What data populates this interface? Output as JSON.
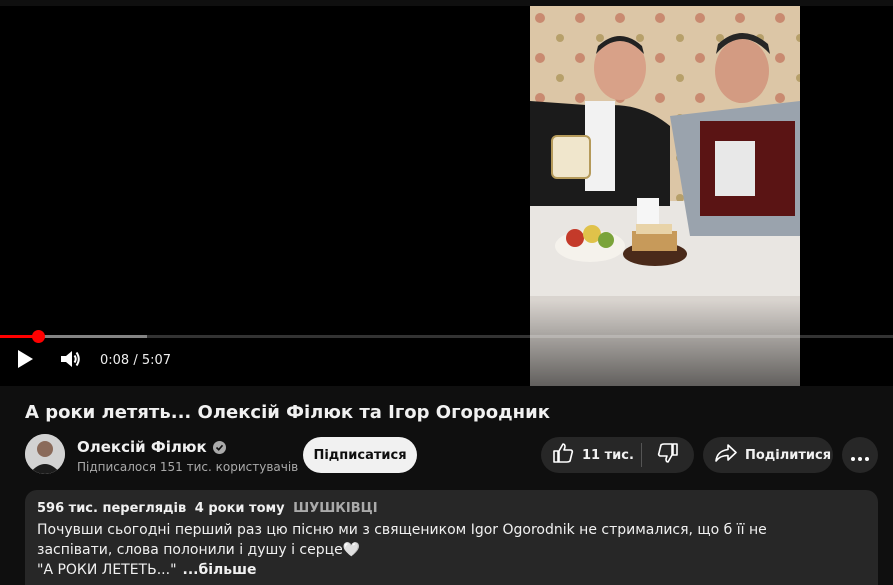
{
  "player": {
    "time_current": "0:08",
    "time_total": "5:07",
    "time_display": "0:08 / 5:07",
    "played_fraction": 0.043,
    "buffered_fraction": 0.165,
    "icons": {
      "play": "play-icon",
      "volume": "volume-icon"
    },
    "colors": {
      "progress": "#ff0000"
    }
  },
  "video": {
    "title": "А роки летять... Олексій Філюк та Ігор Огородник"
  },
  "channel": {
    "name": "Олексій Філюк",
    "subscribers": "Підписалося 151 тис. користувачів",
    "verified_icon": "verified-check-icon"
  },
  "actions": {
    "subscribe": "Підписатися",
    "likes": "11 тис.",
    "share": "Поділитися",
    "icons": {
      "like": "thumb-up-icon",
      "dislike": "thumb-down-icon",
      "share": "share-arrow-icon",
      "more": "more-dots-icon"
    }
  },
  "description": {
    "views": "596 тис. переглядів",
    "date": "4 роки тому",
    "hashtag": "ШУШКІВЦІ",
    "text_line1": "Почувши сьогодні перший раз цю пісню ми з священиком Igor Ogorodnik  не стрималися, що б її не заспівати, слова полонили і душу і серце🤍",
    "text_line3": "\"А РОКИ ЛЕТЕТЬ...\"",
    "more_label": "...більше"
  }
}
